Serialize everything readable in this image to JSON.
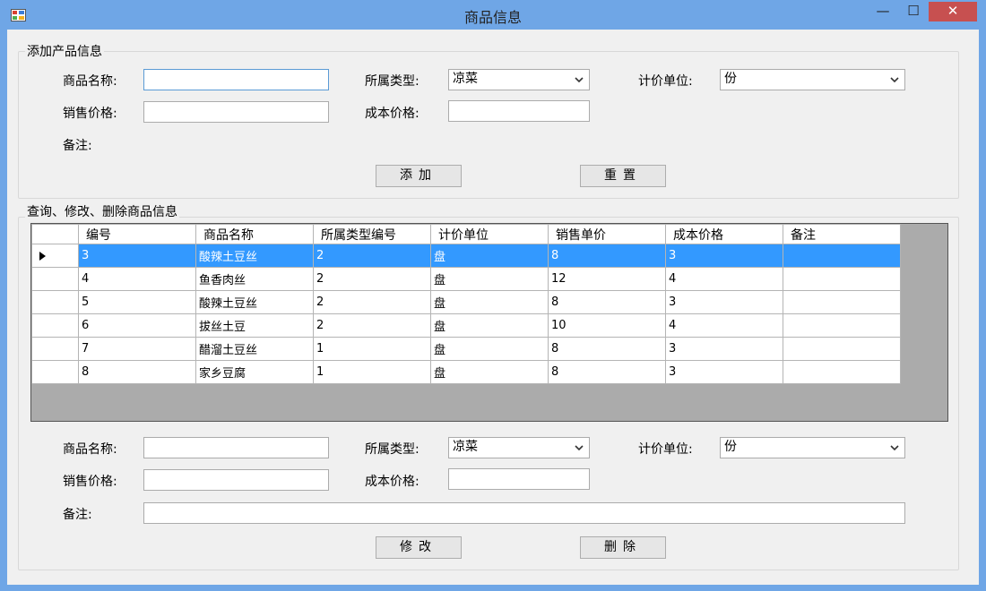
{
  "window": {
    "title": "商品信息",
    "min": "—",
    "max": "☐",
    "close": "✕"
  },
  "add_group": {
    "title": "添加产品信息",
    "name_label": "商品名称:",
    "name_value": "",
    "type_label": "所属类型:",
    "type_value": "凉菜",
    "unit_label": "计价单位:",
    "unit_value": "份",
    "price_label": "销售价格:",
    "price_value": "",
    "cost_label": "成本价格:",
    "cost_value": "",
    "note_label": "备注:",
    "add_button": "添加",
    "reset_button": "重置"
  },
  "edit_group": {
    "title": "查询、修改、删除商品信息",
    "name_label": "商品名称:",
    "name_value": "",
    "type_label": "所属类型:",
    "type_value": "凉菜",
    "unit_label": "计价单位:",
    "unit_value": "份",
    "price_label": "销售价格:",
    "price_value": "",
    "cost_label": "成本价格:",
    "cost_value": "",
    "note_label": "备注:",
    "note_value": "",
    "modify_button": "修改",
    "delete_button": "删除"
  },
  "grid": {
    "columns": [
      "编号",
      "商品名称",
      "所属类型编号",
      "计价单位",
      "销售单价",
      "成本价格",
      "备注"
    ],
    "rows": [
      [
        "3",
        "酸辣土豆丝",
        "2",
        "盘",
        "8",
        "3",
        ""
      ],
      [
        "4",
        "鱼香肉丝",
        "2",
        "盘",
        "12",
        "4",
        ""
      ],
      [
        "5",
        "酸辣土豆丝",
        "2",
        "盘",
        "8",
        "3",
        ""
      ],
      [
        "6",
        "拔丝土豆",
        "2",
        "盘",
        "10",
        "4",
        ""
      ],
      [
        "7",
        "醋溜土豆丝",
        "1",
        "盘",
        "8",
        "3",
        ""
      ],
      [
        "8",
        "家乡豆腐",
        "1",
        "盘",
        "8",
        "3",
        ""
      ]
    ],
    "selected_row": 0
  },
  "colors": {
    "title_bar": "#6fa6e6",
    "selection": "#3399ff",
    "close_button": "#c75050"
  }
}
